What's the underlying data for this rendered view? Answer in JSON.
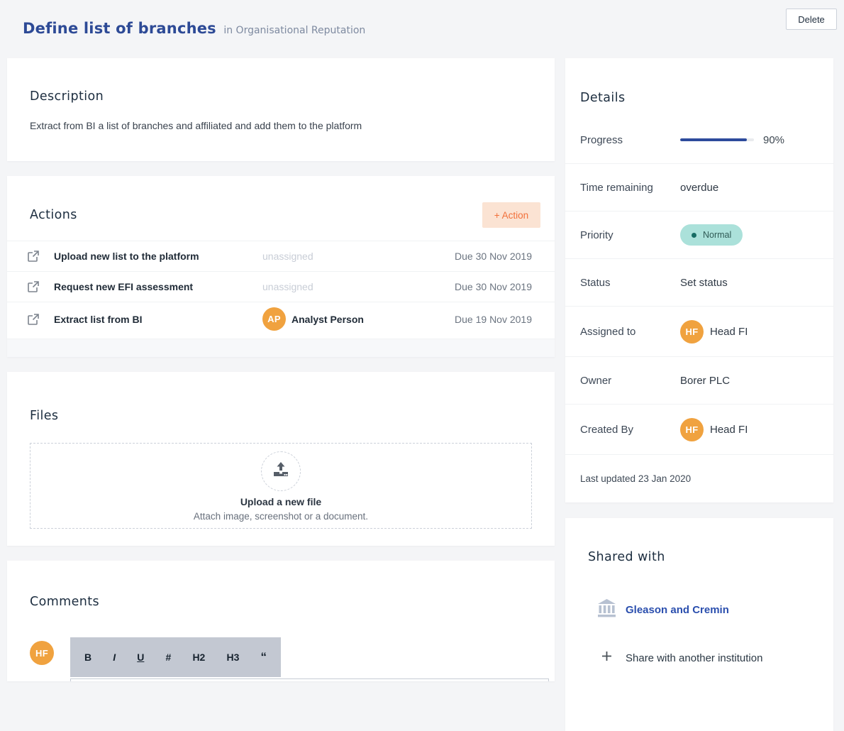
{
  "header": {
    "title": "Define list of branches",
    "subtitle": "in Organisational Reputation",
    "delete_label": "Delete"
  },
  "description": {
    "heading": "Description",
    "body": "Extract from BI a list of branches and affiliated and add them to the platform"
  },
  "actions": {
    "heading": "Actions",
    "add_label": "+ Action",
    "rows": [
      {
        "title": "Upload new list to the platform",
        "assignee": "unassigned",
        "due": "Due 30 Nov 2019"
      },
      {
        "title": "Request new EFI assessment",
        "assignee": "unassigned",
        "due": "Due 30 Nov 2019"
      },
      {
        "title": "Extract list from BI",
        "assignee": "Analyst Person",
        "assignee_initials": "AP",
        "due": "Due 19 Nov 2019"
      }
    ]
  },
  "files": {
    "heading": "Files",
    "upload_title": "Upload a new file",
    "upload_subtitle": "Attach image, screenshot or a document."
  },
  "comments": {
    "heading": "Comments",
    "avatar_initials": "HF",
    "toolbar": [
      "B",
      "I",
      "U",
      "#",
      "H2",
      "H3",
      "“"
    ]
  },
  "details": {
    "heading": "Details",
    "progress_label": "Progress",
    "progress_percent": 90,
    "progress_text": "90%",
    "time_label": "Time remaining",
    "time_value": "overdue",
    "priority_label": "Priority",
    "priority_value": "Normal",
    "status_label": "Status",
    "status_value": "Set status",
    "assigned_label": "Assigned to",
    "assigned_value": "Head FI",
    "assigned_initials": "HF",
    "owner_label": "Owner",
    "owner_value": "Borer PLC",
    "created_label": "Created By",
    "created_value": "Head FI",
    "created_initials": "HF",
    "last_updated": "Last updated 23 Jan 2020"
  },
  "shared": {
    "heading": "Shared with",
    "institution": "Gleason and Cremin",
    "add_label": "Share with another institution"
  },
  "colors": {
    "accent_blue": "#2d4a96",
    "progress_blue": "#2d4b9c",
    "avatar_orange": "#f0a23f",
    "action_button_bg": "#fbe3d3",
    "action_button_text": "#f2703a",
    "priority_pill_bg": "#abe1da",
    "priority_dot": "#176c64",
    "link_blue": "#2b4fae",
    "page_bg": "#f4f5f7"
  }
}
